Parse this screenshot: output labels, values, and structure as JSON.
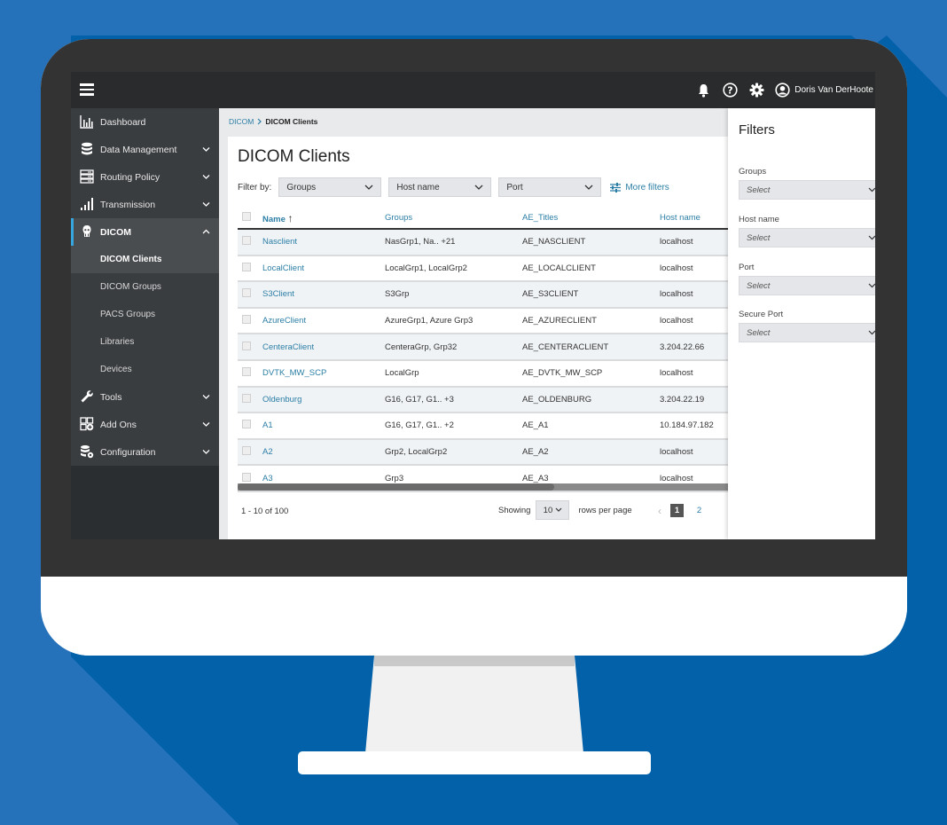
{
  "topbar": {
    "user_name": "Doris Van DerHoote",
    "icons": [
      "menu-icon",
      "bell-icon",
      "help-icon",
      "gear-icon",
      "user-icon"
    ]
  },
  "sidebar": {
    "items": [
      {
        "label": "Dashboard",
        "icon": "bar-chart-icon",
        "expandable": false
      },
      {
        "label": "Data Management",
        "icon": "database-icon",
        "expandable": true
      },
      {
        "label": "Routing Policy",
        "icon": "server-icon",
        "expandable": true
      },
      {
        "label": "Transmission",
        "icon": "signal-icon",
        "expandable": true
      },
      {
        "label": "DICOM",
        "icon": "dicom-icon",
        "expandable": true,
        "expanded": true
      },
      {
        "label": "Tools",
        "icon": "wrench-icon",
        "expandable": true
      },
      {
        "label": "Add Ons",
        "icon": "add-ons-icon",
        "expandable": true
      },
      {
        "label": "Configuration",
        "icon": "config-icon",
        "expandable": true
      }
    ],
    "dicom_sub": [
      "DICOM Clients",
      "DICOM Groups",
      "PACS Groups",
      "Libraries",
      "Devices"
    ]
  },
  "breadcrumb": {
    "parent": "DICOM",
    "current": "DICOM Clients"
  },
  "page": {
    "title": "DICOM Clients",
    "filter_by_label": "Filter by:",
    "filters": [
      "Groups",
      "Host name",
      "Port"
    ],
    "more_filters": "More filters"
  },
  "table": {
    "columns": [
      "Name",
      "Groups",
      "AE_Titles",
      "Host name"
    ],
    "sort_indicator": "↑",
    "rows": [
      {
        "name": "Nasclient",
        "groups": "NasGrp1, Na.. +21",
        "ae": "AE_NASCLIENT",
        "host": "localhost"
      },
      {
        "name": "LocalClient",
        "groups": "LocalGrp1, LocalGrp2",
        "ae": "AE_LOCALCLIENT",
        "host": "localhost"
      },
      {
        "name": "S3Client",
        "groups": "S3Grp",
        "ae": "AE_S3CLIENT",
        "host": "localhost"
      },
      {
        "name": "AzureClient",
        "groups": "AzureGrp1, Azure Grp3",
        "ae": "AE_AZURECLIENT",
        "host": "localhost"
      },
      {
        "name": "CenteraClient",
        "groups": "CenteraGrp, Grp32",
        "ae": "AE_CENTERACLIENT",
        "host": "3.204.22.66"
      },
      {
        "name": "DVTK_MW_SCP",
        "groups": "LocalGrp",
        "ae": "AE_DVTK_MW_SCP",
        "host": "localhost"
      },
      {
        "name": "Oldenburg",
        "groups": "G16, G17, G1.. +3",
        "ae": "AE_OLDENBURG",
        "host": "3.204.22.19"
      },
      {
        "name": "A1",
        "groups": "G16, G17, G1.. +2",
        "ae": "AE_A1",
        "host": "10.184.97.182"
      },
      {
        "name": "A2",
        "groups": "Grp2, LocalGrp2",
        "ae": "AE_A2",
        "host": "localhost"
      },
      {
        "name": "A3",
        "groups": "Grp3",
        "ae": "AE_A3",
        "host": "localhost"
      }
    ]
  },
  "pagination": {
    "range": "1 - 10 of 100",
    "showing_label": "Showing",
    "rows_per_page": "10",
    "rows_per_page_label": "rows per page",
    "pages": [
      "1",
      "2"
    ],
    "current_page": "1"
  },
  "filters_panel": {
    "title": "Filters",
    "fields": [
      {
        "label": "Groups",
        "placeholder": "Select"
      },
      {
        "label": "Host name",
        "placeholder": "Select"
      },
      {
        "label": "Port",
        "placeholder": "Select"
      },
      {
        "label": "Secure Port",
        "placeholder": "Select"
      }
    ]
  },
  "colors": {
    "background": "#0261a9",
    "accent": "#2b7ea5",
    "active_indicator": "#36a6de",
    "bezel": "#333333"
  }
}
